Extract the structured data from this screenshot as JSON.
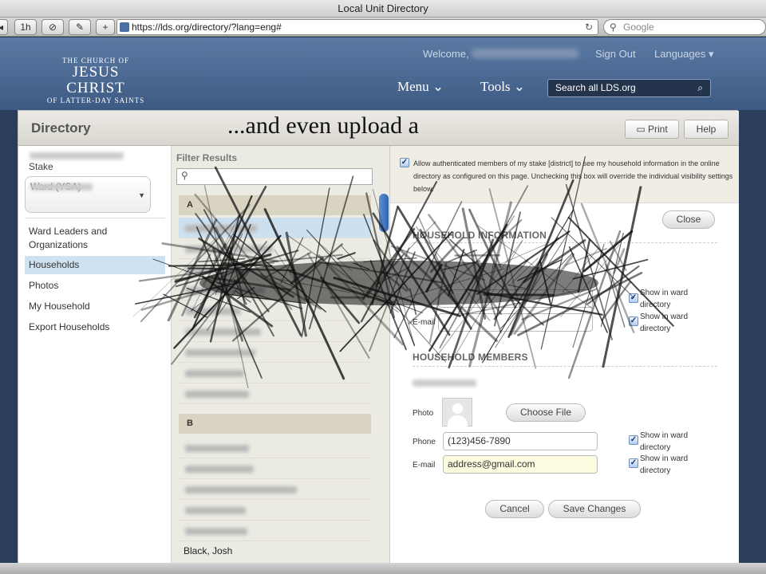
{
  "window": {
    "title": "Local Unit Directory"
  },
  "browser": {
    "history_label": "1h",
    "url": "https://lds.org/directory/?lang=eng#",
    "search_placeholder": "Google"
  },
  "site": {
    "logo": {
      "line1": "THE CHURCH OF",
      "line2": "JESUS CHRIST",
      "line3": "OF LATTER-DAY SAINTS"
    },
    "welcome": "Welcome,",
    "sign_out": "Sign Out",
    "languages": "Languages ▾",
    "menu": "Menu ⌄",
    "tools": "Tools ⌄",
    "search_placeholder": "Search all LDS.org"
  },
  "panel": {
    "title": "Directory",
    "overlay_caption": "...and even upload a",
    "print_label": "Print",
    "help_label": "Help"
  },
  "sidebar": {
    "stake_label": "Stake",
    "ward_select": "Ward (YSA)",
    "items": [
      {
        "label": "Ward Leaders and Organizations",
        "active": false
      },
      {
        "label": "Households",
        "active": true
      },
      {
        "label": "Photos",
        "active": false
      },
      {
        "label": "My Household",
        "active": false
      },
      {
        "label": "Export Households",
        "active": false
      }
    ]
  },
  "filter": {
    "label": "Filter Results",
    "letters": [
      "A",
      "B"
    ],
    "visible_name": "Black, Josh"
  },
  "household": {
    "auth_text": "Allow authenticated members of my stake [district] to see my household information in the online directory as configured on this page. Unchecking this box will override the individual visibility settings below.",
    "close_label": "Close",
    "info_heading": "HOUSEHOLD INFORMATION",
    "members_heading": "HOUSEHOLD MEMBERS",
    "email_label": "E-mail",
    "photo_label": "Photo",
    "choose_file": "Choose File",
    "phone_label": "Phone",
    "phone_value": "(123)456-7890",
    "member_email_label": "E-mail",
    "email_value": "address@gmail.com",
    "show_in_ward": "Show in ward directory",
    "cancel_label": "Cancel",
    "save_label": "Save Changes"
  },
  "icons": [
    "back-icon",
    "stop-icon",
    "evernote-icon",
    "add-tab-icon",
    "reload-icon",
    "search-icon",
    "printer-icon",
    "dropdown-caret-icon",
    "person-placeholder-icon",
    "checkbox-icon"
  ],
  "colors": {
    "header_blue": "#4a6a95",
    "active_nav": "#cfe2f2",
    "letter_band": "#d9d3c1",
    "scroll_thumb": "#3a72c4"
  }
}
